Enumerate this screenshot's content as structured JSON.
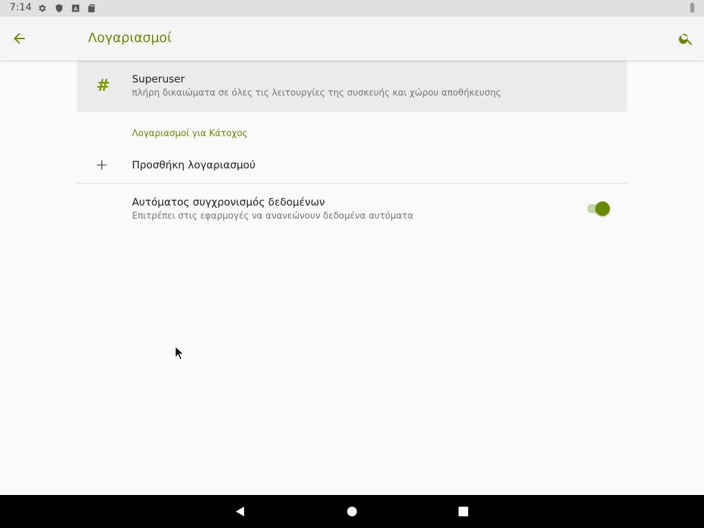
{
  "status_bar": {
    "time": "7:14",
    "icons": [
      "settings-gear-icon",
      "shield-icon",
      "a-badge-icon",
      "sd-card-icon",
      "battery-icon"
    ]
  },
  "app_bar": {
    "title": "Λογαριασμοί",
    "back_icon": "arrow-back-icon",
    "search_icon": "search-icon",
    "accent_color": "#6b8a00"
  },
  "accounts": [
    {
      "icon": "#",
      "title": "Superuser",
      "subtitle": "πλήρη δικαιώματα σε όλες τις λειτουργίες της συσκευής και χώρου αποθήκευσης"
    }
  ],
  "section_header": "Λογαριασμοί για Κάτοχος",
  "add_account": {
    "icon": "plus-icon",
    "label": "Προσθήκη λογαριασμού"
  },
  "auto_sync": {
    "title": "Αυτόματος συγχρονισμός δεδομένων",
    "subtitle": "Επιτρέπει στις εφαρμογές να ανανεώνουν δεδομένα αυτόματα",
    "enabled": true
  },
  "nav_bar": {
    "icons": [
      "back-triangle-icon",
      "home-circle-icon",
      "recents-square-icon"
    ]
  }
}
